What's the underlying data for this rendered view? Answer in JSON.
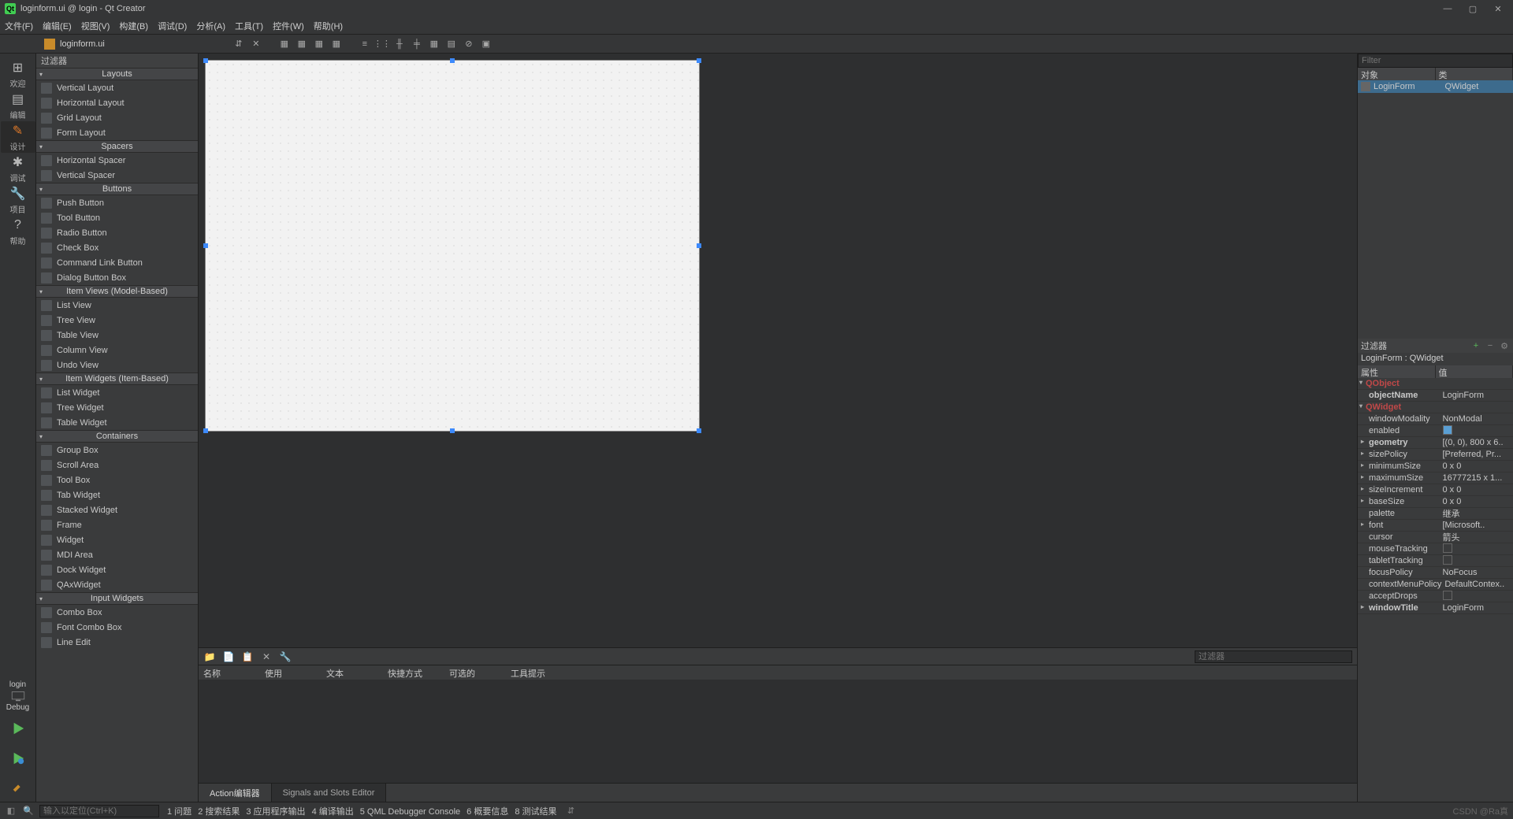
{
  "title": "loginform.ui @ login - Qt Creator",
  "menus": [
    "文件(F)",
    "编辑(E)",
    "视图(V)",
    "构建(B)",
    "调试(D)",
    "分析(A)",
    "工具(T)",
    "控件(W)",
    "帮助(H)"
  ],
  "opentab": "loginform.ui",
  "modes": [
    {
      "icon": "⊞",
      "label": "欢迎"
    },
    {
      "icon": "▤",
      "label": "编辑"
    },
    {
      "icon": "✎",
      "label": "设计",
      "active": true,
      "orange": true
    },
    {
      "icon": "✱",
      "label": "调试"
    },
    {
      "icon": "🔧",
      "label": "项目"
    },
    {
      "icon": "?",
      "label": "帮助"
    }
  ],
  "kit": {
    "name": "login",
    "config": "Debug"
  },
  "widgetbox": {
    "title": "过滤器",
    "cats": [
      {
        "name": "Layouts",
        "items": [
          "Vertical Layout",
          "Horizontal Layout",
          "Grid Layout",
          "Form Layout"
        ]
      },
      {
        "name": "Spacers",
        "items": [
          "Horizontal Spacer",
          "Vertical Spacer"
        ]
      },
      {
        "name": "Buttons",
        "items": [
          "Push Button",
          "Tool Button",
          "Radio Button",
          "Check Box",
          "Command Link Button",
          "Dialog Button Box"
        ]
      },
      {
        "name": "Item Views (Model-Based)",
        "items": [
          "List View",
          "Tree View",
          "Table View",
          "Column View",
          "Undo View"
        ]
      },
      {
        "name": "Item Widgets (Item-Based)",
        "items": [
          "List Widget",
          "Tree Widget",
          "Table Widget"
        ]
      },
      {
        "name": "Containers",
        "items": [
          "Group Box",
          "Scroll Area",
          "Tool Box",
          "Tab Widget",
          "Stacked Widget",
          "Frame",
          "Widget",
          "MDI Area",
          "Dock Widget",
          "QAxWidget"
        ]
      },
      {
        "name": "Input Widgets",
        "items": [
          "Combo Box",
          "Font Combo Box",
          "Line Edit"
        ]
      }
    ]
  },
  "action_filter": "过滤器",
  "action_cols": {
    "name": "名称",
    "used": "使用",
    "text": "文本",
    "shortcut": "快捷方式",
    "checkable": "可选的",
    "tooltip": "工具提示"
  },
  "bottomtabs": [
    "Action编辑器",
    "Signals and Slots Editor"
  ],
  "objfilter": "Filter",
  "objhdr": {
    "obj": "对象",
    "cls": "类"
  },
  "objtree": {
    "name": "LoginForm",
    "cls": "QWidget"
  },
  "propfilter": "过滤器",
  "classlabel": "LoginForm : QWidget",
  "prophdr": {
    "prop": "属性",
    "val": "值"
  },
  "props": [
    {
      "group": true,
      "name": "QObject"
    },
    {
      "name": "objectName",
      "val": "LoginForm",
      "bold": true
    },
    {
      "group": true,
      "name": "QWidget"
    },
    {
      "name": "windowModality",
      "val": "NonModal"
    },
    {
      "name": "enabled",
      "cb": true,
      "checked": true
    },
    {
      "name": "geometry",
      "val": "[(0, 0), 800 x 6..",
      "arrow": true,
      "bold": true
    },
    {
      "name": "sizePolicy",
      "val": "[Preferred, Pr...",
      "arrow": true
    },
    {
      "name": "minimumSize",
      "val": "0 x 0",
      "arrow": true
    },
    {
      "name": "maximumSize",
      "val": "16777215 x 1...",
      "arrow": true
    },
    {
      "name": "sizeIncrement",
      "val": "0 x 0",
      "arrow": true
    },
    {
      "name": "baseSize",
      "val": "0 x 0",
      "arrow": true
    },
    {
      "name": "palette",
      "val": "继承"
    },
    {
      "name": "font",
      "val": "[Microsoft..",
      "arrow": true
    },
    {
      "name": "cursor",
      "val": "箭头"
    },
    {
      "name": "mouseTracking",
      "cb": true,
      "checked": false
    },
    {
      "name": "tabletTracking",
      "cb": true,
      "checked": false
    },
    {
      "name": "focusPolicy",
      "val": "NoFocus"
    },
    {
      "name": "contextMenuPolicy",
      "val": "DefaultContex.."
    },
    {
      "name": "acceptDrops",
      "cb": true,
      "checked": false
    },
    {
      "name": "windowTitle",
      "val": "LoginForm",
      "arrow": true,
      "bold": true
    }
  ],
  "status": {
    "locator": "输入以定位(Ctrl+K)",
    "panes": [
      "1 问题",
      "2 搜索结果",
      "3 应用程序输出",
      "4 编译输出",
      "5 QML Debugger Console",
      "6 概要信息",
      "8 测试结果"
    ],
    "watermark": "CSDN @Ra真"
  }
}
